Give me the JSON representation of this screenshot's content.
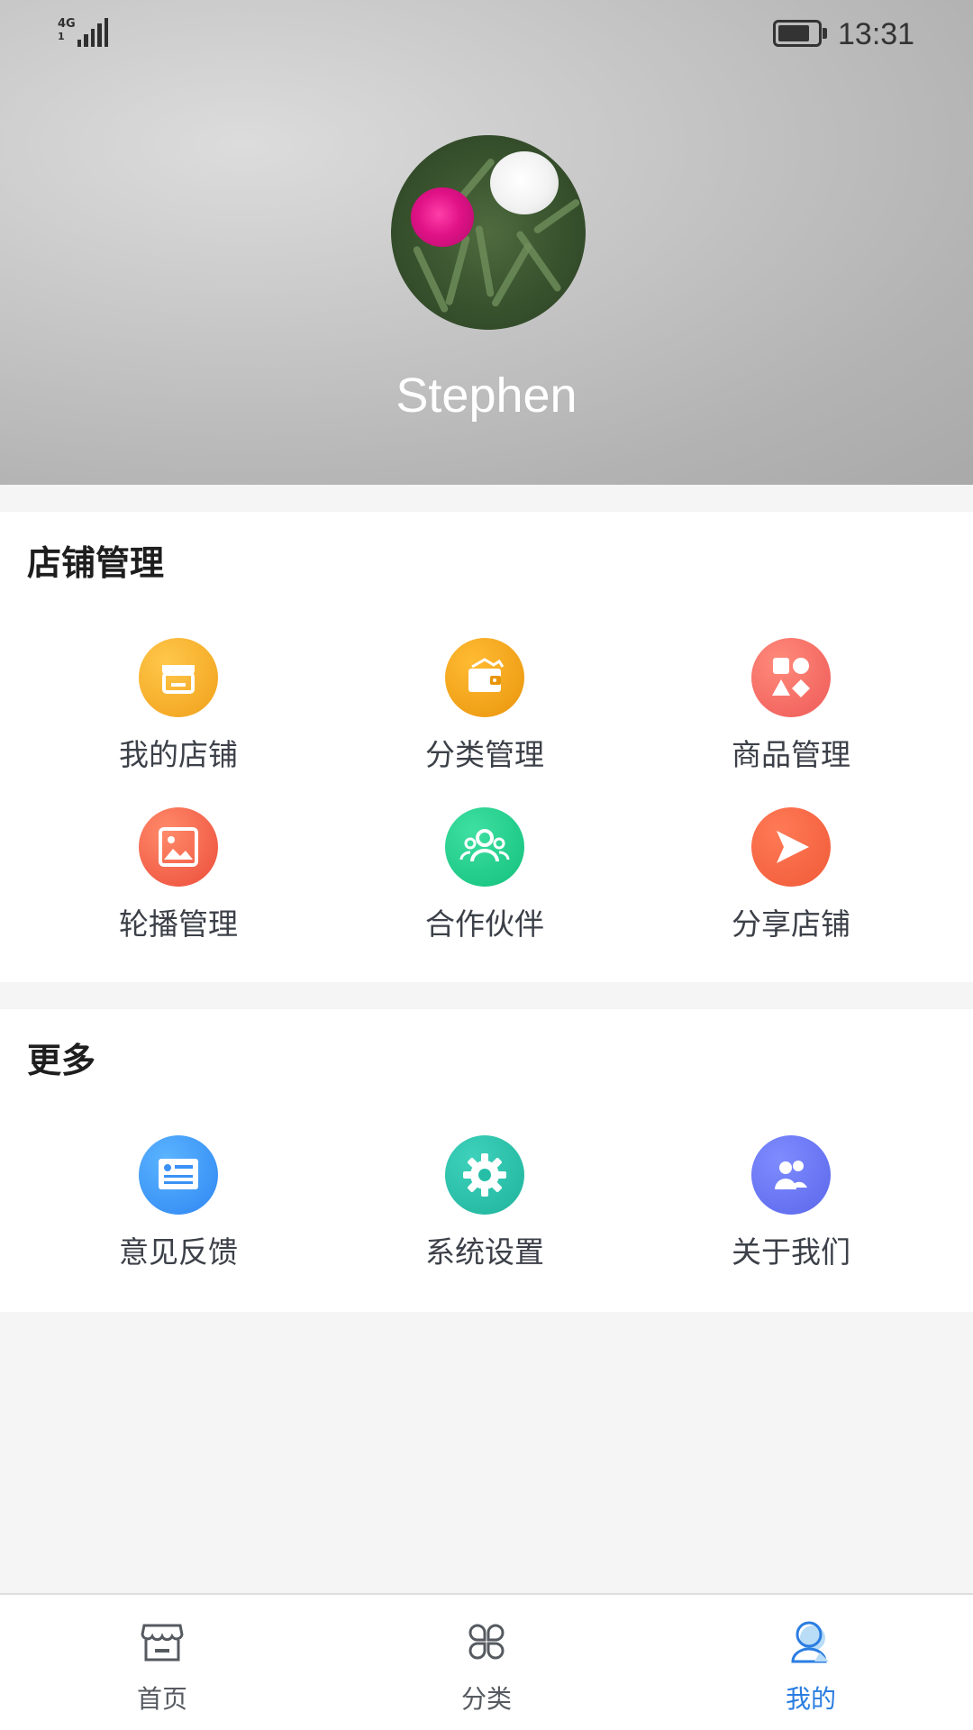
{
  "status_bar": {
    "network_top": "4G",
    "network_bottom": "1",
    "time": "13:31"
  },
  "profile": {
    "username": "Stephen"
  },
  "store_section": {
    "title": "店铺管理",
    "items": [
      {
        "label": "我的店铺",
        "icon": "store-icon",
        "color": "#f5a623"
      },
      {
        "label": "分类管理",
        "icon": "wallet-icon",
        "color": "#f2a017"
      },
      {
        "label": "商品管理",
        "icon": "shapes-icon",
        "color": "#f06a64"
      },
      {
        "label": "轮播管理",
        "icon": "image-icon",
        "color": "#f15a45"
      },
      {
        "label": "合作伙伴",
        "icon": "partners-icon",
        "color": "#1dca87"
      },
      {
        "label": "分享店铺",
        "icon": "share-icon",
        "color": "#f36443"
      }
    ]
  },
  "more_section": {
    "title": "更多",
    "items": [
      {
        "label": "意见反馈",
        "icon": "feedback-icon",
        "color": "#3a91f5"
      },
      {
        "label": "系统设置",
        "icon": "settings-gear-icon",
        "color": "#26bea7"
      },
      {
        "label": "关于我们",
        "icon": "about-us-icon",
        "color": "#6672ee"
      }
    ]
  },
  "tabbar": {
    "tabs": [
      {
        "label": "首页",
        "icon": "home-store-icon",
        "active": false
      },
      {
        "label": "分类",
        "icon": "category-icon",
        "active": false
      },
      {
        "label": "我的",
        "icon": "profile-icon",
        "active": true
      }
    ],
    "active_color": "#2a7de1"
  }
}
